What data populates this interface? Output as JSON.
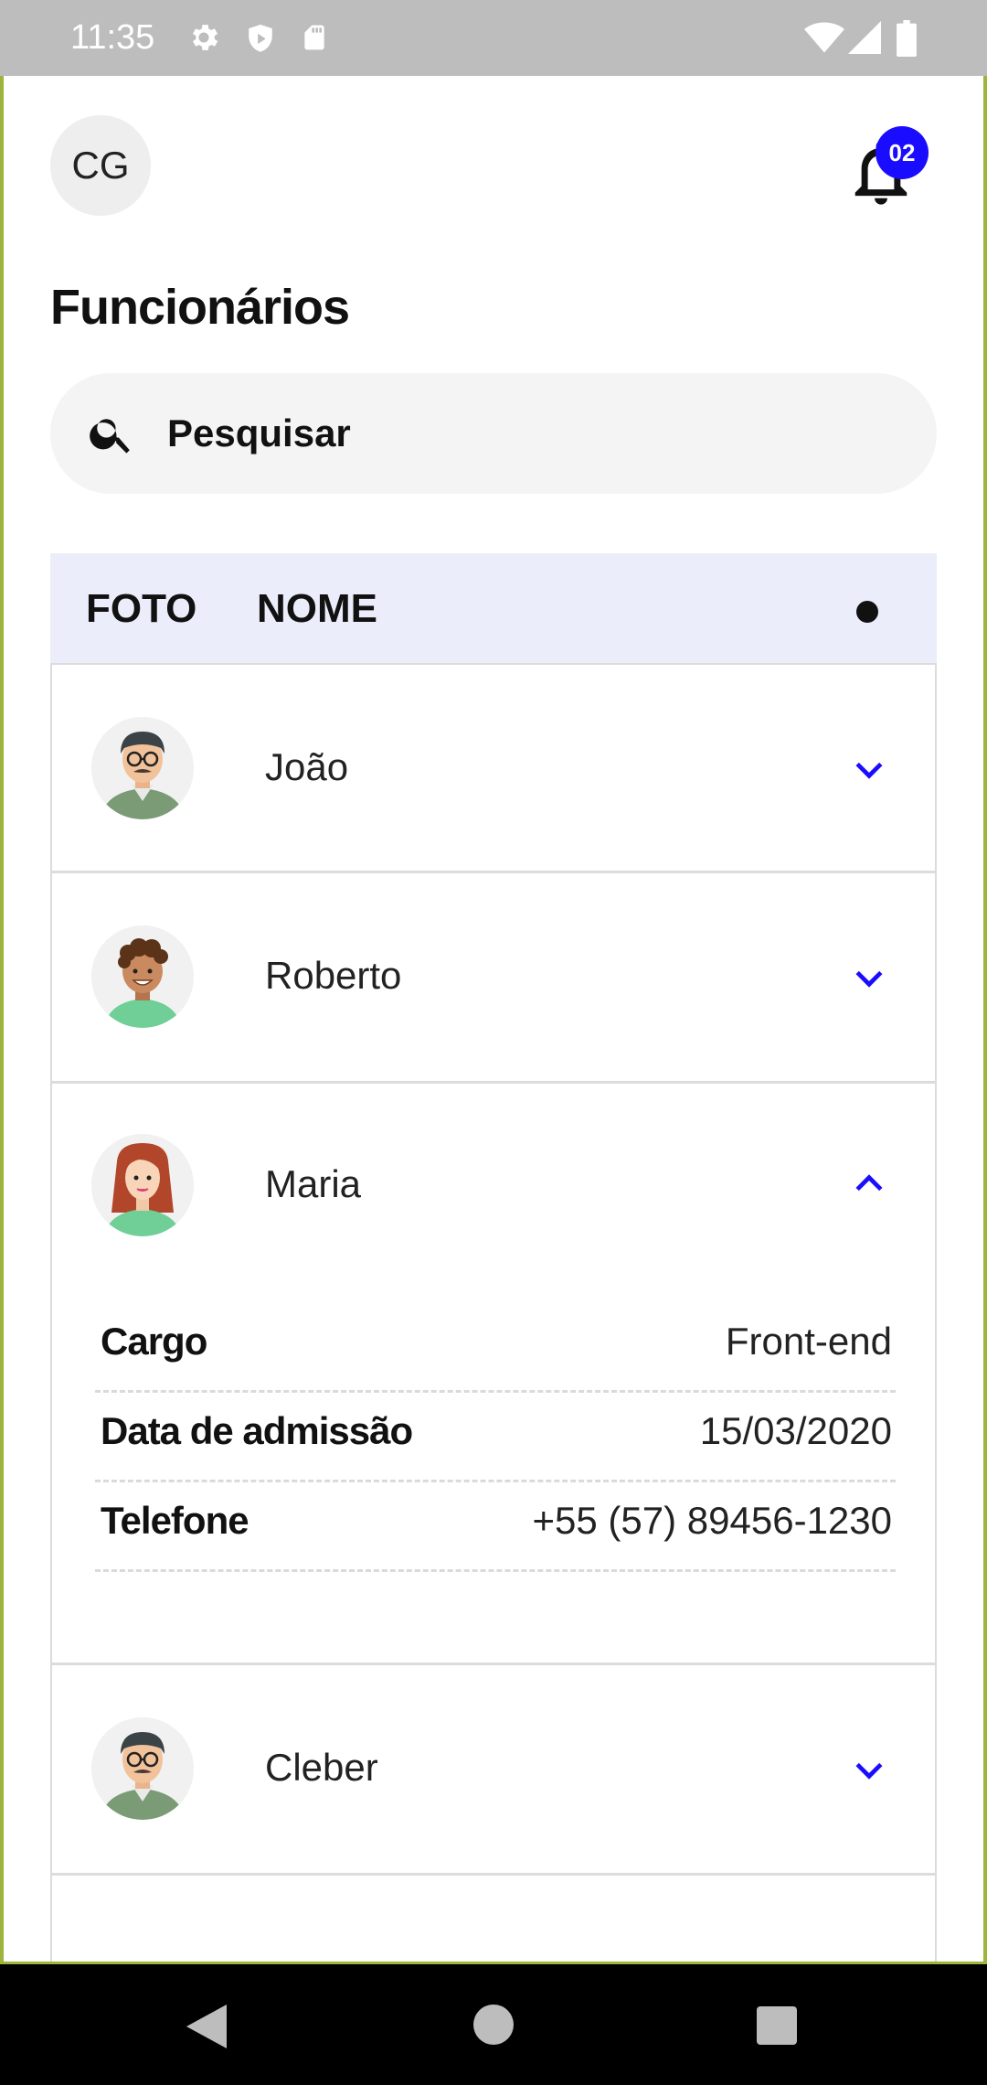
{
  "status_bar": {
    "time": "11:35",
    "icons": [
      "gear-icon",
      "shield-icon",
      "sd-card-icon",
      "wifi-icon",
      "signal-icon",
      "battery-icon"
    ]
  },
  "header": {
    "avatar_initials": "CG",
    "notification_count": "02",
    "notification_icon": "bell-icon"
  },
  "page": {
    "title": "Funcionários"
  },
  "search": {
    "placeholder": "Pesquisar",
    "icon": "search-icon"
  },
  "table": {
    "columns": [
      "FOTO",
      "NOME",
      "●"
    ],
    "rows": [
      {
        "name": "João",
        "expanded": false,
        "avatar": "man-glasses-mustache"
      },
      {
        "name": "Roberto",
        "expanded": false,
        "avatar": "boy-curly-hair"
      },
      {
        "name": "Maria",
        "expanded": true,
        "avatar": "woman-red-hair",
        "details": [
          {
            "label": "Cargo",
            "value": "Front-end"
          },
          {
            "label": "Data de admissão",
            "value": "15/03/2020"
          },
          {
            "label": "Telefone",
            "value": "+55 (57) 89456-1230"
          }
        ]
      },
      {
        "name": "Cleber",
        "expanded": false,
        "avatar": "man-glasses-mustache"
      }
    ]
  },
  "colors": {
    "accent": "#1a0dff",
    "header_bg": "#ebeefa",
    "status_bar": "#bdbdbd"
  },
  "nav_bar": {
    "buttons": [
      "back-icon",
      "home-icon",
      "recents-icon"
    ]
  }
}
